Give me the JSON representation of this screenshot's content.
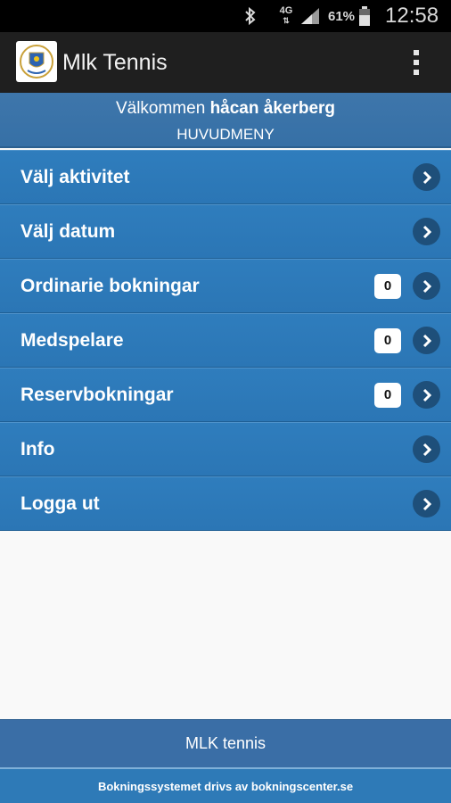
{
  "statusbar": {
    "network": "4G",
    "battery_percent": "61%",
    "time": "12:58"
  },
  "appbar": {
    "title": "Mlk Tennis"
  },
  "header": {
    "welcome_prefix": "Välkommen",
    "user_name": "håcan åkerberg",
    "section": "HUVUDMENY"
  },
  "menu": [
    {
      "label": "Välj aktivitet",
      "badge": null
    },
    {
      "label": "Välj datum",
      "badge": null
    },
    {
      "label": "Ordinarie bokningar",
      "badge": "0"
    },
    {
      "label": "Medspelare",
      "badge": "0"
    },
    {
      "label": "Reservbokningar",
      "badge": "0"
    },
    {
      "label": "Info",
      "badge": null
    },
    {
      "label": "Logga ut",
      "badge": null
    }
  ],
  "footer": {
    "title": "MLK tennis",
    "powered_by": "Bokningssystemet drivs av bokningscenter.se"
  },
  "colors": {
    "accent": "#2b76b5",
    "header": "#3670a6",
    "appbar": "#1f1f1f"
  }
}
